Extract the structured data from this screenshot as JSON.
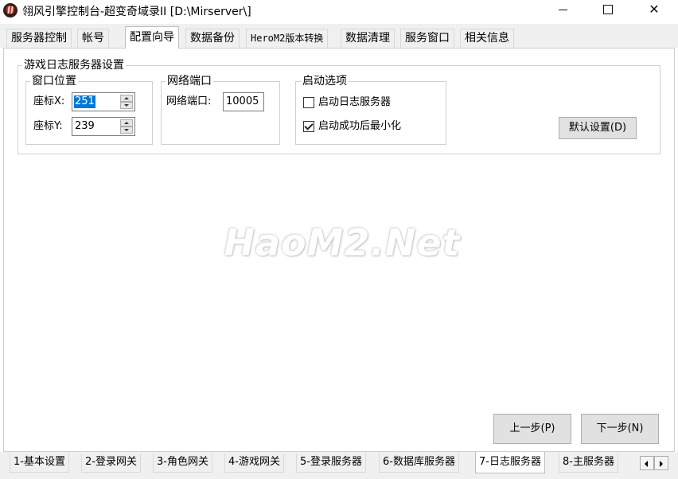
{
  "window": {
    "title": "翎风引擎控制台-超变奇域录II [D:\\Mirserver\\]",
    "minimize": "—",
    "maximize": "☐",
    "close": "✕"
  },
  "top_tabs": [
    {
      "label": "服务器控制",
      "active": false
    },
    {
      "label": "帐号",
      "active": false
    },
    {
      "label": "配置向导",
      "active": true
    },
    {
      "label": "数据备份",
      "active": false
    },
    {
      "label": "HeroM2版本转换",
      "active": false
    },
    {
      "label": "数据清理",
      "active": false
    },
    {
      "label": "服务窗口",
      "active": false
    },
    {
      "label": "相关信息",
      "active": false
    }
  ],
  "log_settings": {
    "title": "游戏日志服务器设置",
    "window_position": {
      "title": "窗口位置",
      "x_label": "座标X:",
      "x_value": "251",
      "y_label": "座标Y:",
      "y_value": "239"
    },
    "network": {
      "title": "网络端口",
      "port_label": "网络端口:",
      "port_value": "10005"
    },
    "startup": {
      "title": "启动选项",
      "option1": {
        "label": "启动日志服务器",
        "checked": false
      },
      "option2": {
        "label": "启动成功后最小化",
        "checked": true
      }
    },
    "default_button": "默认设置(D)"
  },
  "watermark": "HaoM2.Net",
  "nav": {
    "prev": "上一步(P)",
    "next": "下一步(N)"
  },
  "bottom_tabs": [
    {
      "label": "1-基本设置",
      "active": false
    },
    {
      "label": "2-登录网关",
      "active": false
    },
    {
      "label": "3-角色网关",
      "active": false
    },
    {
      "label": "4-游戏网关",
      "active": false
    },
    {
      "label": "5-登录服务器",
      "active": false
    },
    {
      "label": "6-数据库服务器",
      "active": false
    },
    {
      "label": "7-日志服务器",
      "active": true
    },
    {
      "label": "8-主服务器",
      "active": false
    }
  ],
  "colors": {
    "selection": "#0078d7",
    "tab_bg": "#f0f0f0",
    "button_bg": "#e1e1e1"
  }
}
